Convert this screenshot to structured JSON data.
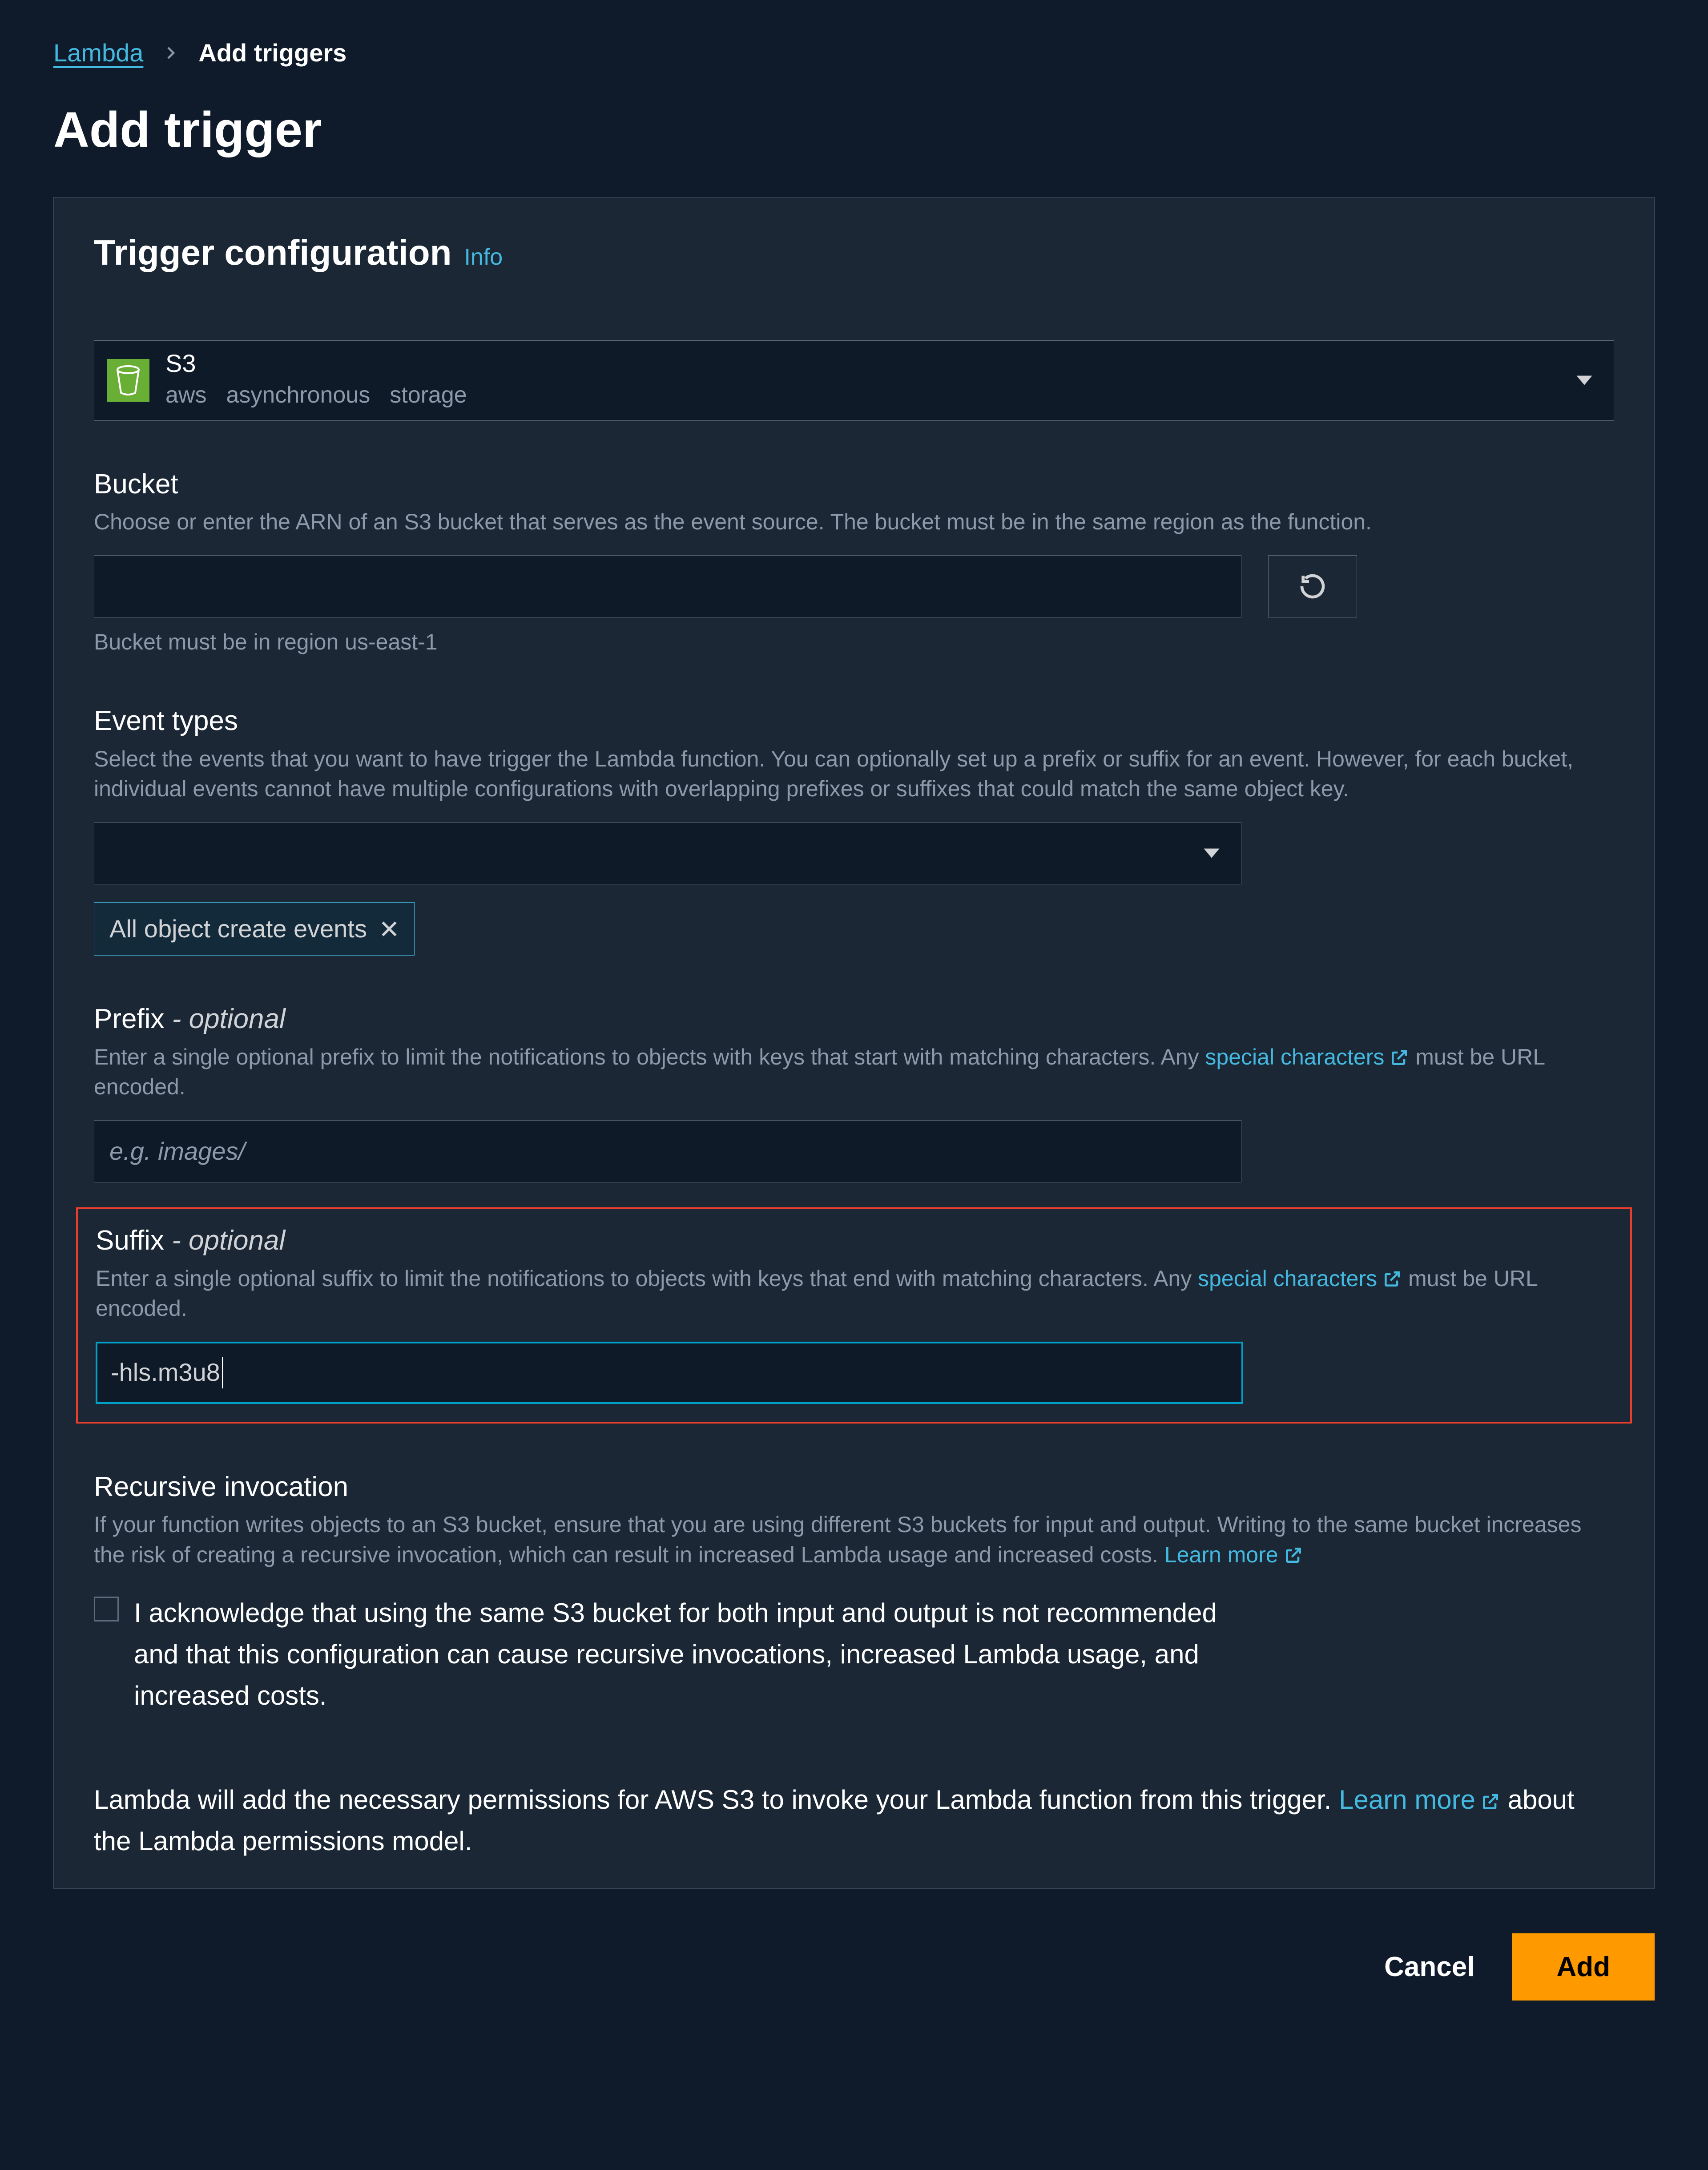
{
  "breadcrumb": {
    "root": "Lambda",
    "current": "Add triggers"
  },
  "page_title": "Add trigger",
  "section_title": "Trigger configuration",
  "info": "Info",
  "source": {
    "name": "S3",
    "tag1": "aws",
    "tag2": "asynchronous",
    "tag3": "storage"
  },
  "bucket": {
    "label": "Bucket",
    "desc": "Choose or enter the ARN of an S3 bucket that serves as the event source. The bucket must be in the same region as the function.",
    "hint": "Bucket must be in region us-east-1"
  },
  "event_types": {
    "label": "Event types",
    "desc": "Select the events that you want to have trigger the Lambda function. You can optionally set up a prefix or suffix for an event. However, for each bucket, individual events cannot have multiple configurations with overlapping prefixes or suffixes that could match the same object key.",
    "chip": "All object create events"
  },
  "prefix": {
    "label": "Prefix",
    "opt": " - optional",
    "desc_pre": "Enter a single optional prefix to limit the notifications to objects with keys that start with matching characters. Any ",
    "link": "special characters",
    "desc_post": " must be URL encoded.",
    "placeholder": "e.g. images/"
  },
  "suffix": {
    "label": "Suffix",
    "opt": " - optional",
    "desc_pre": "Enter a single optional suffix to limit the notifications to objects with keys that end with matching characters. Any ",
    "link": "special characters",
    "desc_post": " must be URL encoded.",
    "value": "-hls.m3u8"
  },
  "recursive": {
    "label": "Recursive invocation",
    "desc_pre": "If your function writes objects to an S3 bucket, ensure that you are using different S3 buckets for input and output. Writing to the same bucket increases the risk of creating a recursive invocation, which can result in increased Lambda usage and increased costs. ",
    "link": "Learn more",
    "ack": "I acknowledge that using the same S3 bucket for both input and output is not recommended and that this configuration can cause recursive invocations, increased Lambda usage, and increased costs."
  },
  "footer_note": {
    "pre": "Lambda will add the necessary permissions for AWS S3 to invoke your Lambda function from this trigger. ",
    "link": "Learn more",
    "post": " about the Lambda permissions model."
  },
  "buttons": {
    "cancel": "Cancel",
    "add": "Add"
  }
}
